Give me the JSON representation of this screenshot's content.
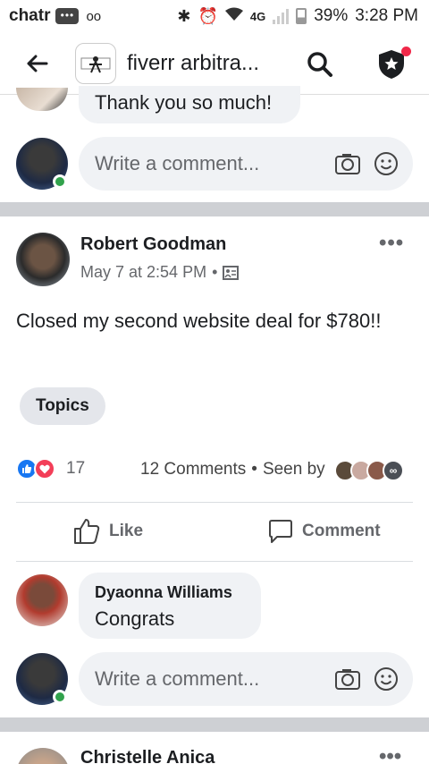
{
  "status": {
    "carrier": "chatr",
    "notif_dots": "•••",
    "voicemail": "oo",
    "network": "4G",
    "battery": "39%",
    "time": "3:28 PM"
  },
  "header": {
    "group_name": "fiverr arbitra..."
  },
  "prev_comment": {
    "text": "Thank you so much!"
  },
  "composer": {
    "placeholder": "Write a comment..."
  },
  "post": {
    "author": "Robert Goodman",
    "date": "May 7 at 2:54 PM",
    "separator": "•",
    "text": "Closed my second website deal for $780!!",
    "topics_label": "Topics",
    "reaction_count": "17",
    "comments_count": "12 Comments",
    "seen_by": "Seen by",
    "seen_more": "∞",
    "like_label": "Like",
    "comment_label": "Comment"
  },
  "comment": {
    "author": "Dyaonna Williams",
    "text": "Congrats"
  },
  "next_post": {
    "author": "Christelle Anica"
  },
  "colors": {
    "accent": "#1877f2",
    "love": "#f33e58",
    "online": "#31a24c",
    "bubble": "#f0f2f5",
    "separator": "#ced0d4"
  }
}
